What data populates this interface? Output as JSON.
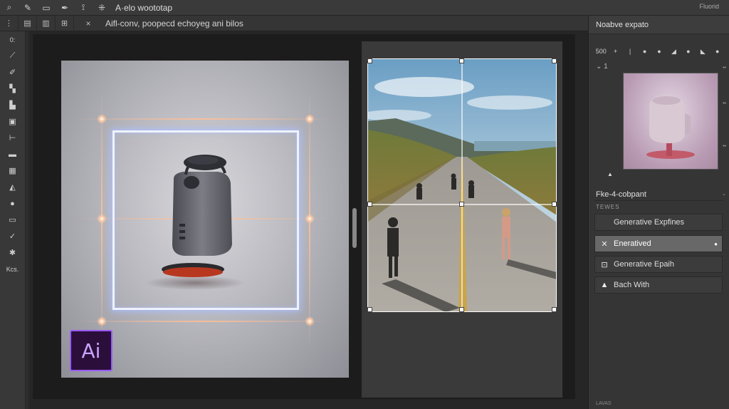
{
  "menubar": {
    "title": "A·elo woototap",
    "right_label": "Fluorid",
    "icons": [
      "search-icon",
      "brush-icon",
      "folder-icon",
      "pen-icon",
      "warp-icon",
      "move-icon"
    ]
  },
  "optbar": {
    "icons": [
      "grid-icon",
      "doc-icon",
      "layers-icon",
      "transform-icon"
    ],
    "close_label": "×",
    "document_title": "Aifl-conv, poopecd echoyeg ani bilos"
  },
  "toolbar": {
    "top_label": "0:",
    "bottom_label": "Kcs.",
    "tools": [
      "select-tool",
      "pen-tool",
      "brush-tool",
      "crop-tool",
      "shape-tool",
      "type-tool",
      "rect-tool",
      "frame-tool",
      "fill-tool",
      "ellipse-tool",
      "hand-tool",
      "check-tool",
      "star-tool"
    ]
  },
  "canvas": {
    "badge_text": "Ai"
  },
  "panel": {
    "header": "Noabve expato",
    "row_label": "500",
    "collapse_label": "1",
    "section_title": "Fke-4-cobpant",
    "section_sub": "TEWES",
    "items": [
      {
        "label": "Generative Expfines",
        "icon": "generate-icon",
        "active": false
      },
      {
        "label": "Eneratived",
        "icon": "frame-icon",
        "active": true
      },
      {
        "label": "Generative  Epaih",
        "icon": "sparkle-icon",
        "active": false
      },
      {
        "label": "Bach With",
        "icon": "mountain-icon",
        "active": false
      }
    ],
    "footer": "LAVAS"
  }
}
